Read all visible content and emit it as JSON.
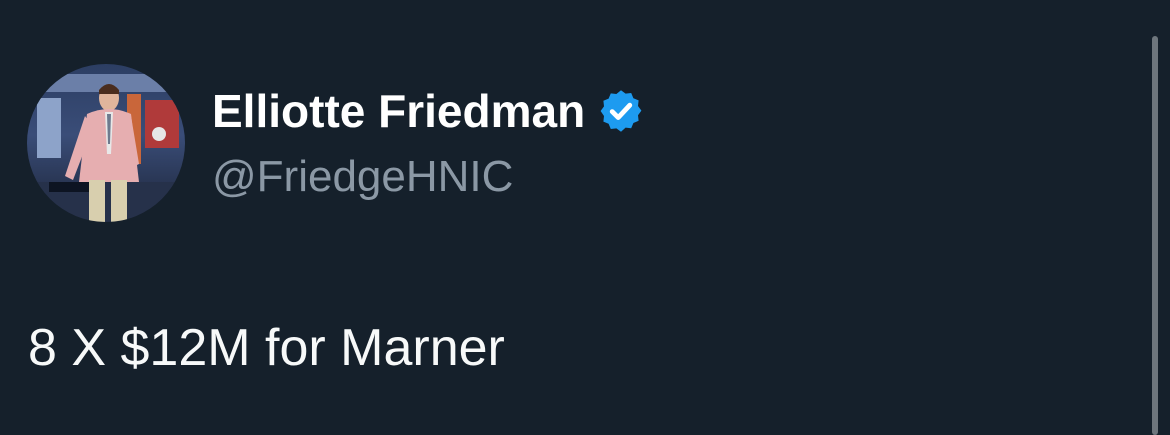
{
  "tweet": {
    "author": {
      "display_name": "Elliotte Friedman",
      "handle": "@FriedgeHNIC",
      "verified": true,
      "avatar_icon": "profile-photo"
    },
    "text": "8 X $12M for Marner"
  },
  "colors": {
    "background": "#15202b",
    "name": "#ffffff",
    "handle": "#8b98a5",
    "text": "#f7f9f9",
    "verified_badge": "#1d9bf0",
    "scrollbar": "#6e767d"
  }
}
